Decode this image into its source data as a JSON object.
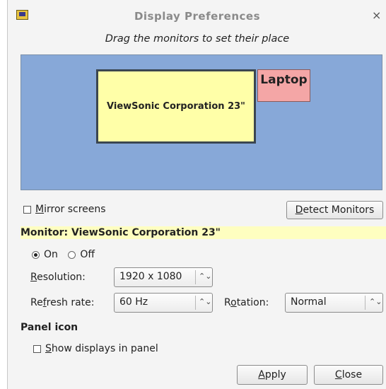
{
  "window": {
    "title": "Display Preferences",
    "close_glyph": "×"
  },
  "layout_area": {
    "instruction": "Drag the monitors to set their place",
    "monitors": [
      {
        "label": "ViewSonic Corporation 23\"",
        "color": "#ffffa8"
      },
      {
        "label": "Laptop",
        "color": "#f4a6a6"
      }
    ],
    "background_color": "#87a8d8"
  },
  "mirror": {
    "mnemonic": "M",
    "rest": "irror screens",
    "checked": false
  },
  "detect_button": {
    "mnemonic": "D",
    "rest": "etect Monitors"
  },
  "monitor_section": {
    "header": "Monitor: ViewSonic Corporation 23\"",
    "on_label": "On",
    "off_label": "Off",
    "selected": "On"
  },
  "resolution": {
    "label_mnemonic": "R",
    "label_rest": "esolution:",
    "value": "1920 x 1080"
  },
  "refresh_rate": {
    "label_pre": "Re",
    "label_mnemonic": "f",
    "label_rest": "resh rate:",
    "value": "60 Hz"
  },
  "rotation": {
    "label_pre": "R",
    "label_mnemonic": "o",
    "label_rest": "tation:",
    "value": "Normal"
  },
  "panel": {
    "heading": "Panel icon",
    "mnemonic": "S",
    "rest": "how displays in panel",
    "checked": false
  },
  "buttons": {
    "apply_mnemonic": "A",
    "apply_rest": "pply",
    "close_mnemonic": "C",
    "close_rest": "lose"
  },
  "icons": {
    "app": "display-preferences-icon",
    "close": "close-icon",
    "spin": "up-down-arrows-icon",
    "spin_glyph": "⌃⌄"
  }
}
